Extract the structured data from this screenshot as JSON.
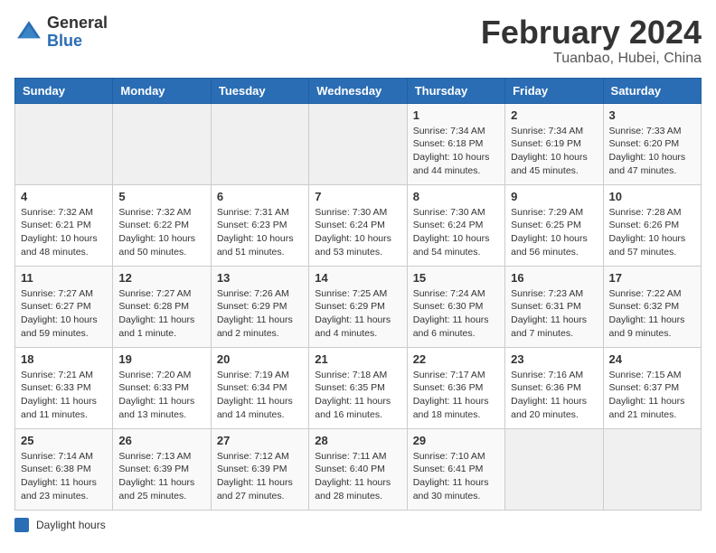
{
  "logo": {
    "general": "General",
    "blue": "Blue"
  },
  "title": "February 2024",
  "location": "Tuanbao, Hubei, China",
  "days_of_week": [
    "Sunday",
    "Monday",
    "Tuesday",
    "Wednesday",
    "Thursday",
    "Friday",
    "Saturday"
  ],
  "weeks": [
    [
      {
        "day": "",
        "info": ""
      },
      {
        "day": "",
        "info": ""
      },
      {
        "day": "",
        "info": ""
      },
      {
        "day": "",
        "info": ""
      },
      {
        "day": "1",
        "info": "Sunrise: 7:34 AM\nSunset: 6:18 PM\nDaylight: 10 hours\nand 44 minutes."
      },
      {
        "day": "2",
        "info": "Sunrise: 7:34 AM\nSunset: 6:19 PM\nDaylight: 10 hours\nand 45 minutes."
      },
      {
        "day": "3",
        "info": "Sunrise: 7:33 AM\nSunset: 6:20 PM\nDaylight: 10 hours\nand 47 minutes."
      }
    ],
    [
      {
        "day": "4",
        "info": "Sunrise: 7:32 AM\nSunset: 6:21 PM\nDaylight: 10 hours\nand 48 minutes."
      },
      {
        "day": "5",
        "info": "Sunrise: 7:32 AM\nSunset: 6:22 PM\nDaylight: 10 hours\nand 50 minutes."
      },
      {
        "day": "6",
        "info": "Sunrise: 7:31 AM\nSunset: 6:23 PM\nDaylight: 10 hours\nand 51 minutes."
      },
      {
        "day": "7",
        "info": "Sunrise: 7:30 AM\nSunset: 6:24 PM\nDaylight: 10 hours\nand 53 minutes."
      },
      {
        "day": "8",
        "info": "Sunrise: 7:30 AM\nSunset: 6:24 PM\nDaylight: 10 hours\nand 54 minutes."
      },
      {
        "day": "9",
        "info": "Sunrise: 7:29 AM\nSunset: 6:25 PM\nDaylight: 10 hours\nand 56 minutes."
      },
      {
        "day": "10",
        "info": "Sunrise: 7:28 AM\nSunset: 6:26 PM\nDaylight: 10 hours\nand 57 minutes."
      }
    ],
    [
      {
        "day": "11",
        "info": "Sunrise: 7:27 AM\nSunset: 6:27 PM\nDaylight: 10 hours\nand 59 minutes."
      },
      {
        "day": "12",
        "info": "Sunrise: 7:27 AM\nSunset: 6:28 PM\nDaylight: 11 hours\nand 1 minute."
      },
      {
        "day": "13",
        "info": "Sunrise: 7:26 AM\nSunset: 6:29 PM\nDaylight: 11 hours\nand 2 minutes."
      },
      {
        "day": "14",
        "info": "Sunrise: 7:25 AM\nSunset: 6:29 PM\nDaylight: 11 hours\nand 4 minutes."
      },
      {
        "day": "15",
        "info": "Sunrise: 7:24 AM\nSunset: 6:30 PM\nDaylight: 11 hours\nand 6 minutes."
      },
      {
        "day": "16",
        "info": "Sunrise: 7:23 AM\nSunset: 6:31 PM\nDaylight: 11 hours\nand 7 minutes."
      },
      {
        "day": "17",
        "info": "Sunrise: 7:22 AM\nSunset: 6:32 PM\nDaylight: 11 hours\nand 9 minutes."
      }
    ],
    [
      {
        "day": "18",
        "info": "Sunrise: 7:21 AM\nSunset: 6:33 PM\nDaylight: 11 hours\nand 11 minutes."
      },
      {
        "day": "19",
        "info": "Sunrise: 7:20 AM\nSunset: 6:33 PM\nDaylight: 11 hours\nand 13 minutes."
      },
      {
        "day": "20",
        "info": "Sunrise: 7:19 AM\nSunset: 6:34 PM\nDaylight: 11 hours\nand 14 minutes."
      },
      {
        "day": "21",
        "info": "Sunrise: 7:18 AM\nSunset: 6:35 PM\nDaylight: 11 hours\nand 16 minutes."
      },
      {
        "day": "22",
        "info": "Sunrise: 7:17 AM\nSunset: 6:36 PM\nDaylight: 11 hours\nand 18 minutes."
      },
      {
        "day": "23",
        "info": "Sunrise: 7:16 AM\nSunset: 6:36 PM\nDaylight: 11 hours\nand 20 minutes."
      },
      {
        "day": "24",
        "info": "Sunrise: 7:15 AM\nSunset: 6:37 PM\nDaylight: 11 hours\nand 21 minutes."
      }
    ],
    [
      {
        "day": "25",
        "info": "Sunrise: 7:14 AM\nSunset: 6:38 PM\nDaylight: 11 hours\nand 23 minutes."
      },
      {
        "day": "26",
        "info": "Sunrise: 7:13 AM\nSunset: 6:39 PM\nDaylight: 11 hours\nand 25 minutes."
      },
      {
        "day": "27",
        "info": "Sunrise: 7:12 AM\nSunset: 6:39 PM\nDaylight: 11 hours\nand 27 minutes."
      },
      {
        "day": "28",
        "info": "Sunrise: 7:11 AM\nSunset: 6:40 PM\nDaylight: 11 hours\nand 28 minutes."
      },
      {
        "day": "29",
        "info": "Sunrise: 7:10 AM\nSunset: 6:41 PM\nDaylight: 11 hours\nand 30 minutes."
      },
      {
        "day": "",
        "info": ""
      },
      {
        "day": "",
        "info": ""
      }
    ]
  ],
  "legend": {
    "daylight_label": "Daylight hours"
  }
}
